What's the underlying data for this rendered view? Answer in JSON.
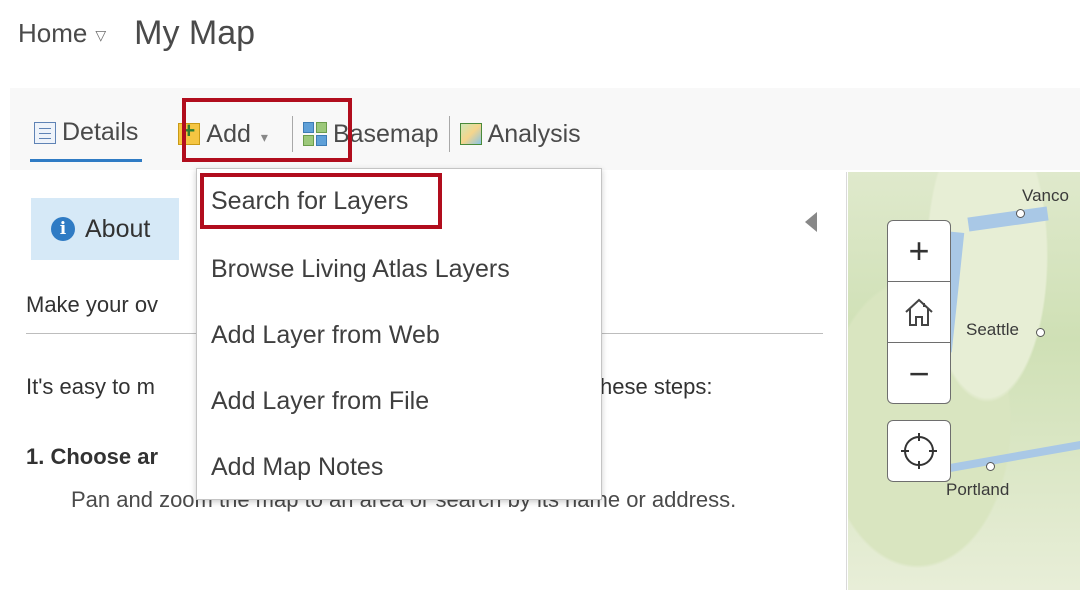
{
  "header": {
    "home_label": "Home",
    "home_caret": "▽",
    "map_title": "My Map"
  },
  "toolbar": {
    "details_label": "Details",
    "add_label": "Add",
    "add_caret": "▾",
    "basemap_label": "Basemap",
    "analysis_label": "Analysis"
  },
  "add_menu": {
    "items": [
      "Search for Layers",
      "Browse Living Atlas Layers",
      "Add Layer from Web",
      "Add Layer from File",
      "Add Map Notes"
    ]
  },
  "panel": {
    "about_label": "About",
    "intro_text": "Make your ov",
    "easy_text_left": "It's easy to m",
    "easy_text_right": "hese steps:",
    "step1_title": "1. Choose ar",
    "step1_body": "Pan and zoom the map to an area or search by its name or address."
  },
  "map": {
    "labels": [
      "Vanco",
      "Seattle",
      "Portland"
    ],
    "zoom_in": "+",
    "zoom_out": "−"
  },
  "colors": {
    "accent": "#2f7bc4",
    "highlight_border": "#b10d1d"
  }
}
